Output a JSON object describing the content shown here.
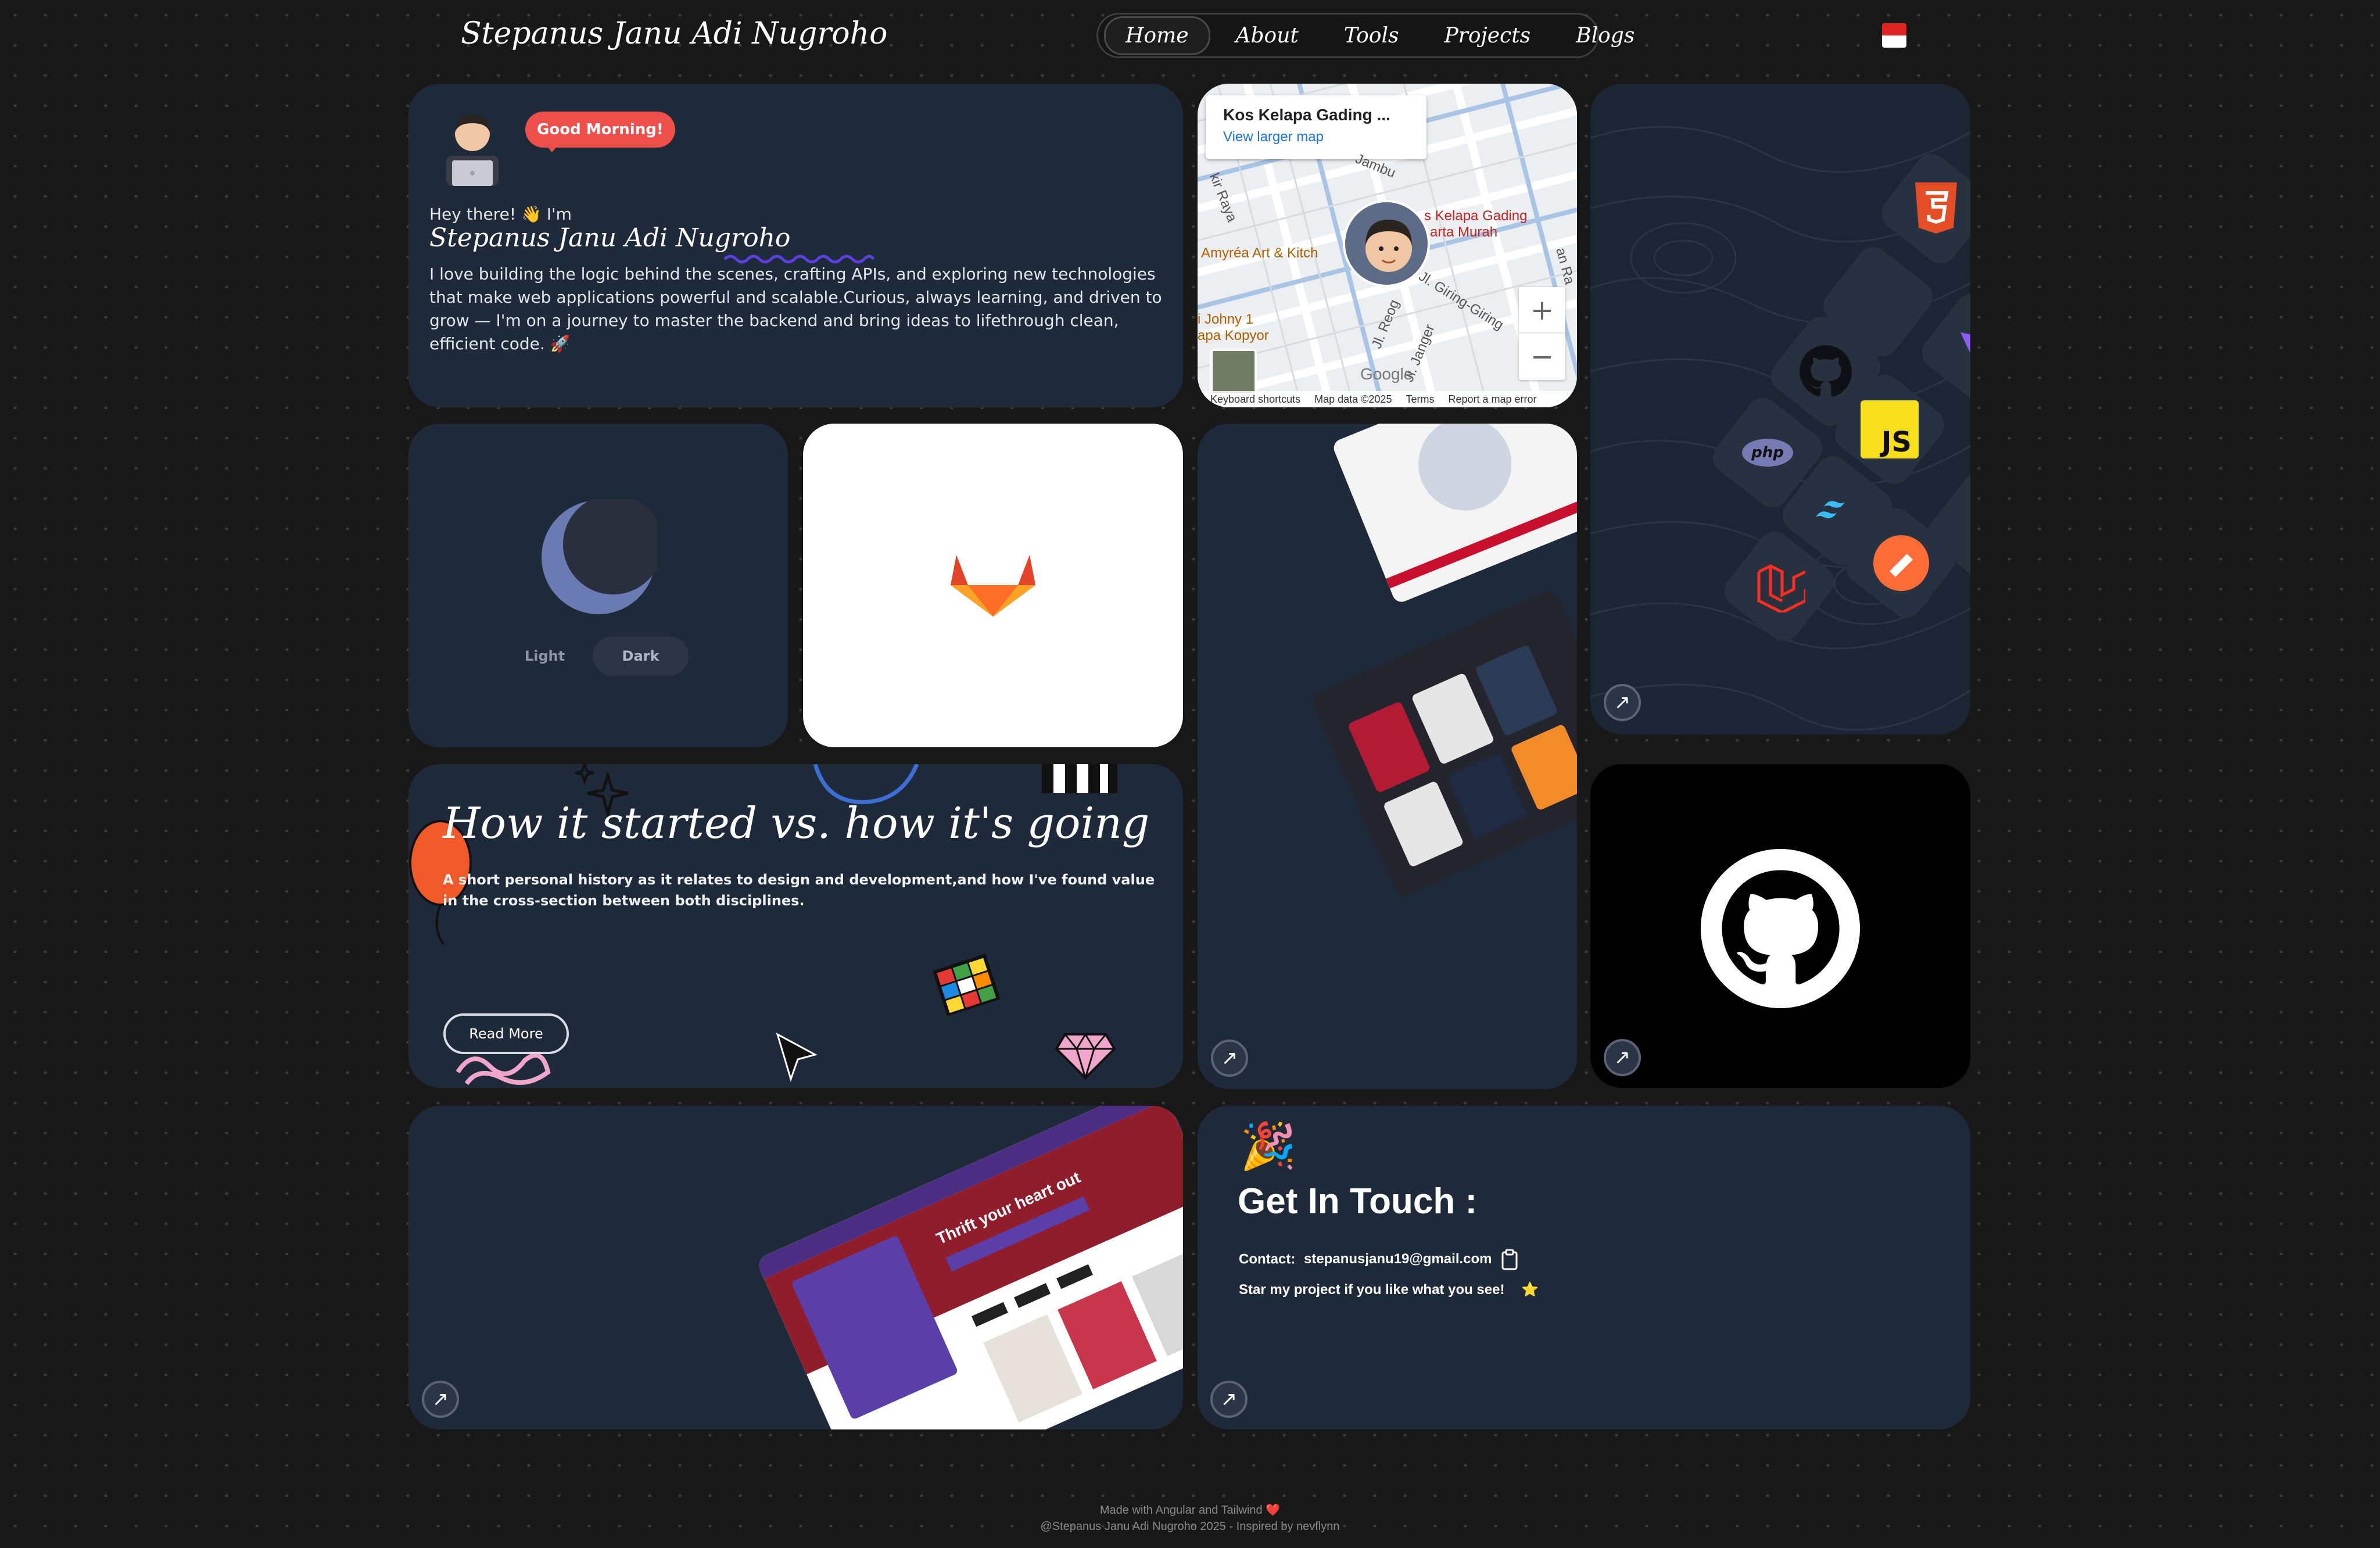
{
  "header": {
    "site_name": "Stepanus Janu Adi Nugroho",
    "nav": [
      "Home",
      "About",
      "Tools",
      "Projects",
      "Blogs"
    ],
    "active": "Home"
  },
  "intro": {
    "badge": "Good Morning!",
    "greeting": "Hey there! 👋 I'm",
    "name": "Stepanus Janu Adi Nugroho",
    "bio": "I love building the logic behind the scenes, crafting APIs, and exploring new technologies that make web applications powerful and scalable.Curious, always learning, and driven to grow — I'm on a journey to master the backend and bring ideas to lifethrough clean, efficient code. 🚀"
  },
  "map": {
    "place": "Kos Kelapa Gading ...",
    "larger": "View larger map",
    "labels": [
      "kir Raya",
      "Jambu",
      "s Kelapa Gading",
      "arta Murah",
      "Amyréa Art & Kitch",
      "Jl. Giring-Giring",
      "Jl. Reog",
      "Jl. Janger",
      "i Johny 1",
      "apa Kopyor",
      "an Ra"
    ],
    "footer": [
      "Keyboard shortcuts",
      "Map data ©2025",
      "Terms",
      "Report a map error"
    ],
    "google": "Google",
    "zoom_in": "+",
    "zoom_out": "−"
  },
  "theme": {
    "light": "Light",
    "dark": "Dark",
    "selected": "Dark"
  },
  "how": {
    "title": "How it started vs. how it's going",
    "desc": "A short personal history as it relates to design and development,and how I've found value in the cross-section between both disciplines.",
    "button": "Read More"
  },
  "tools_icons": [
    "html5-icon",
    "github-icon",
    "php-icon",
    "javascript-icon",
    "tailwind-icon",
    "laravel-icon",
    "postman-icon"
  ],
  "contact": {
    "emoji": "🎉",
    "title": "Get In Touch :",
    "label": "Contact:",
    "email": "stepanusjanu19@gmail.com",
    "star_text": "Star my project if you like what you see!",
    "star": "⭐"
  },
  "thrift": {
    "heading": "Thrift your heart out"
  },
  "footer": {
    "line1": "Made with Angular and Tailwind ❤️",
    "line2": "@Stepanus Janu Adi Nugroho 2025 - Inspired by nevflynn"
  },
  "arrow_glyph": "↗",
  "colors": {
    "card": "#1e2939",
    "bg": "#181818",
    "badge": "#ef4f4a",
    "gitlab": "#fc6d26"
  }
}
